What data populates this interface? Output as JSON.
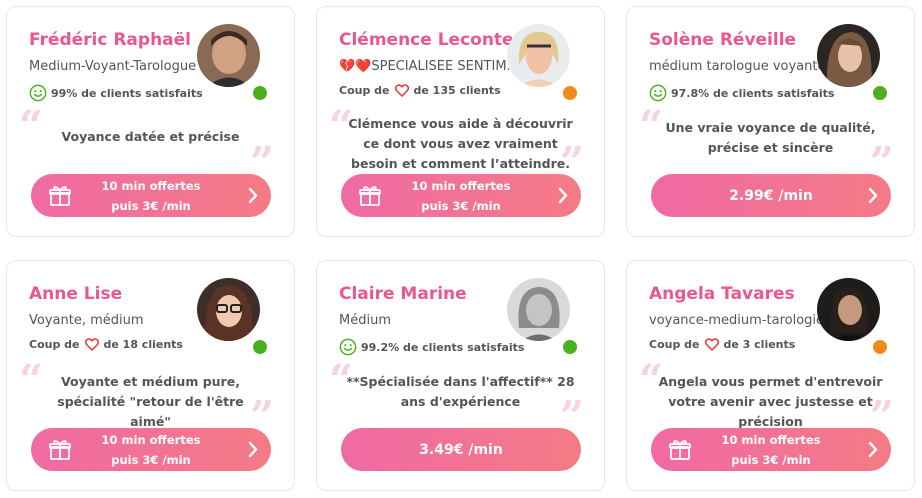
{
  "colors": {
    "accent": "#e9578f",
    "online": "#4caf1f",
    "busy": "#f18a1e",
    "quote": "#f8d3df"
  },
  "cards": [
    {
      "name": "Frédéric Raphaël",
      "subtitle": "Medium-Voyant-Tarologue",
      "stat_type": "satisfaction",
      "stat": "99% de clients satisfaits",
      "description": "Voyance datée et précise",
      "cta_line1": "10 min offertes",
      "cta_line2": "puis 3€ /min",
      "cta_type": "gift",
      "status": "online"
    },
    {
      "name": "Clémence Leconte",
      "subtitle": "💔❤️SPECIALISEE SENTIM...",
      "stat_type": "hearts",
      "stat_prefix": "Coup de",
      "stat": "de 135 clients",
      "description": "Clémence vous aide à découvrir ce dont vous avez vraiment besoin et comment l’atteindre.",
      "cta_line1": "10 min offertes",
      "cta_line2": "puis 3€ /min",
      "cta_type": "gift",
      "status": "busy"
    },
    {
      "name": "Solène Réveille",
      "subtitle": "médium tarologue voyante",
      "stat_type": "satisfaction",
      "stat": "97.8% de clients satisfaits",
      "description": "Une vraie voyance de qualité, précise et sincère",
      "cta_price": "2.99€ /min",
      "cta_type": "price",
      "status": "online"
    },
    {
      "name": "Anne Lise",
      "subtitle": "Voyante, médium",
      "stat_type": "hearts",
      "stat_prefix": "Coup de",
      "stat": "de 18 clients",
      "description": "Voyante et médium pure, spécialité \"retour de l'être aimé\"",
      "cta_line1": "10 min offertes",
      "cta_line2": "puis 3€ /min",
      "cta_type": "gift",
      "status": "online"
    },
    {
      "name": "Claire Marine",
      "subtitle": "Médium",
      "stat_type": "satisfaction",
      "stat": "99.2% de clients satisfaits",
      "description": "**Spécialisée dans l'affectif** 28 ans d'expérience",
      "cta_price": "3.49€ /min",
      "cta_type": "price",
      "status": "online"
    },
    {
      "name": "Angela Tavares",
      "subtitle": "voyance-medium-tarologie",
      "stat_type": "hearts",
      "stat_prefix": "Coup de",
      "stat": "de 3 clients",
      "description": "Angela vous permet d'entrevoir votre avenir avec justesse et précision",
      "cta_line1": "10 min offertes",
      "cta_line2": "puis 3€ /min",
      "cta_type": "gift",
      "status": "busy"
    }
  ]
}
